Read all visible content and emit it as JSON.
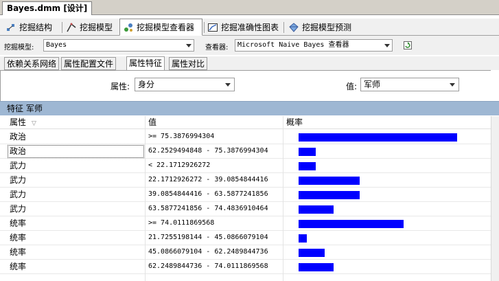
{
  "document_tab": {
    "label": "Bayes.dmm [设计]"
  },
  "designer_tabs": [
    {
      "label": "挖掘结构",
      "icon": "mining-structure-icon"
    },
    {
      "label": "挖掘模型",
      "icon": "mining-model-icon"
    },
    {
      "label": "挖掘模型查看器",
      "icon": "model-viewer-icon",
      "active": true
    },
    {
      "label": "挖掘准确性图表",
      "icon": "accuracy-chart-icon"
    },
    {
      "label": "挖掘模型预测",
      "icon": "prediction-diamond-icon"
    }
  ],
  "toolbar": {
    "model_label": "挖掘模型:",
    "model_value": "Bayes",
    "viewer_label": "查看器:",
    "viewer_value": "Microsoft Naive Bayes 查看器",
    "refresh_icon": "refresh-icon"
  },
  "subtabs": [
    {
      "label": "依赖关系网络"
    },
    {
      "label": "属性配置文件"
    },
    {
      "label": "属性特征",
      "active": true
    },
    {
      "label": "属性对比"
    }
  ],
  "filter": {
    "attribute_label": "属性:",
    "attribute_value": "身分",
    "value_label": "值:",
    "value_value": "军师"
  },
  "feature_header": "特征 军师",
  "grid": {
    "columns": [
      "属性",
      "值",
      "概率"
    ],
    "sort_icon": "sort-arrow-icon",
    "bar_color": "#0000ff",
    "rows": [
      {
        "attribute": "政治",
        "value": ">= 75.3876994304",
        "probability": 0.77
      },
      {
        "attribute": "政治",
        "value": "62.2529494848 - 75.3876994304",
        "probability": 0.083
      },
      {
        "attribute": "武力",
        "value": "< 22.1712926272",
        "probability": 0.083
      },
      {
        "attribute": "武力",
        "value": "22.1712926272 - 39.0854844416",
        "probability": 0.297
      },
      {
        "attribute": "武力",
        "value": "39.0854844416 - 63.5877241856",
        "probability": 0.297
      },
      {
        "attribute": "武力",
        "value": "63.5877241856 - 74.4836910464",
        "probability": 0.17
      },
      {
        "attribute": "统率",
        "value": ">= 74.0111869568",
        "probability": 0.51
      },
      {
        "attribute": "统率",
        "value": "21.7255198144 - 45.0866079104",
        "probability": 0.04
      },
      {
        "attribute": "统率",
        "value": "45.0866079104 - 62.2489844736",
        "probability": 0.127
      },
      {
        "attribute": "统率",
        "value": "62.2489844736 - 74.0111869568",
        "probability": 0.17
      }
    ]
  }
}
